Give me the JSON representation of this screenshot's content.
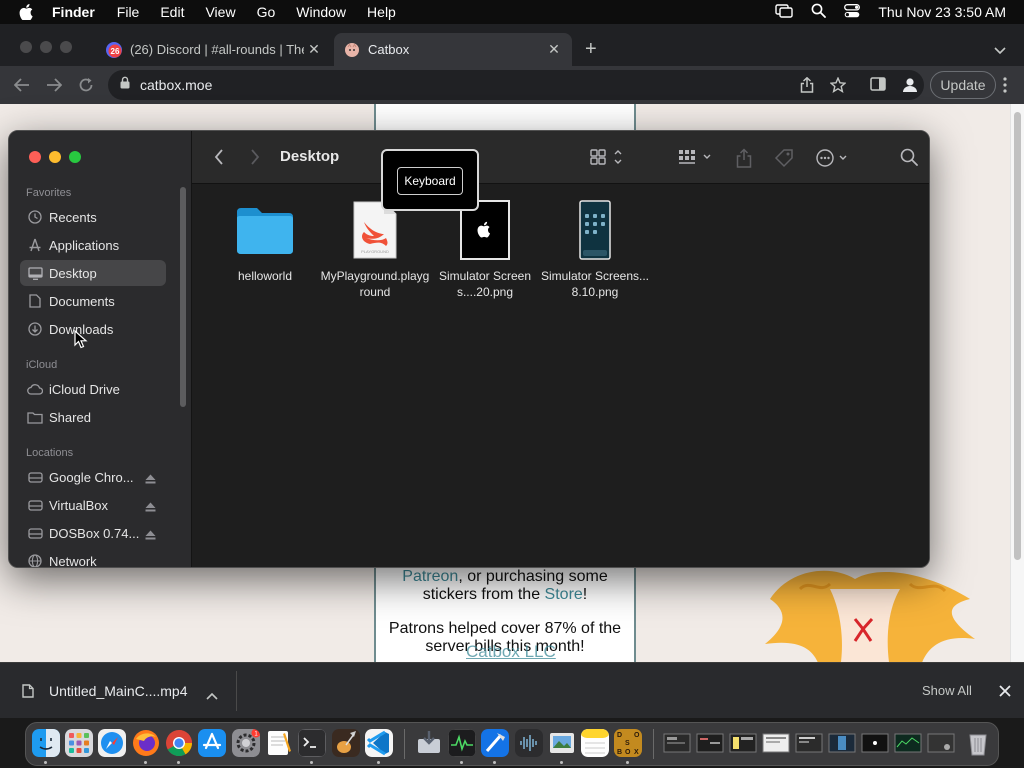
{
  "menubar": {
    "app_name": "Finder",
    "items": [
      "File",
      "Edit",
      "View",
      "Go",
      "Window",
      "Help"
    ],
    "clock": "Thu Nov 23  3:50 AM"
  },
  "browser": {
    "tabs": [
      {
        "title": "(26) Discord | #all-rounds | The",
        "badge": "26",
        "active": false
      },
      {
        "title": "Catbox",
        "active": true
      }
    ],
    "url": "catbox.moe",
    "update_label": "Update"
  },
  "webpage": {
    "line1_link": "Patreon",
    "line1_rest": ", or purchasing some",
    "line2_text": "stickers from the ",
    "line2_link": "Store",
    "line2_end": "!",
    "patrons_line1": "Patrons helped cover 87% of the",
    "patrons_line2": "server bills this month!",
    "footer": "Catbox LLC"
  },
  "finder": {
    "location_title": "Desktop",
    "sidebar": {
      "favorites_header": "Favorites",
      "favorites": [
        {
          "label": "Recents",
          "icon": "clock-icon"
        },
        {
          "label": "Applications",
          "icon": "applications-icon"
        },
        {
          "label": "Desktop",
          "icon": "desktop-icon",
          "selected": true
        },
        {
          "label": "Documents",
          "icon": "document-icon"
        },
        {
          "label": "Downloads",
          "icon": "download-icon"
        }
      ],
      "icloud_header": "iCloud",
      "icloud": [
        {
          "label": "iCloud Drive",
          "icon": "cloud-icon"
        },
        {
          "label": "Shared",
          "icon": "shared-folder-icon"
        }
      ],
      "locations_header": "Locations",
      "locations": [
        {
          "label": "Google Chro...",
          "icon": "disk-icon"
        },
        {
          "label": "VirtualBox",
          "icon": "disk-icon"
        },
        {
          "label": "DOSBox 0.74...",
          "icon": "disk-icon"
        },
        {
          "label": "Network",
          "icon": "network-icon"
        }
      ]
    },
    "files": [
      {
        "name": "helloworld",
        "kind": "folder"
      },
      {
        "name": "MyPlayground.playground",
        "kind": "playground"
      },
      {
        "name": "Simulator Screens....20.png",
        "kind": "image-black"
      },
      {
        "name": "Simulator Screens...8.10.png",
        "kind": "image-phone"
      }
    ],
    "playground_badge": "PLAYGROUND",
    "tooltip": "Keyboard"
  },
  "download_bar": {
    "file_name": "Untitled_MainC....mp4",
    "show_all": "Show All"
  },
  "dock": {
    "notification_badge": "1",
    "dosbox_letters": [
      "D",
      "O",
      "S",
      "B",
      "O",
      "X"
    ]
  },
  "colors": {
    "finder_bg": "#1e1e1e",
    "sidebar_bg": "#2b2b2d",
    "folder_blue": "#2ea8e6",
    "catbox_link": "#3e8a98",
    "traffic_red": "#fe5f57",
    "traffic_yellow": "#febc2e",
    "traffic_green": "#28c840"
  }
}
